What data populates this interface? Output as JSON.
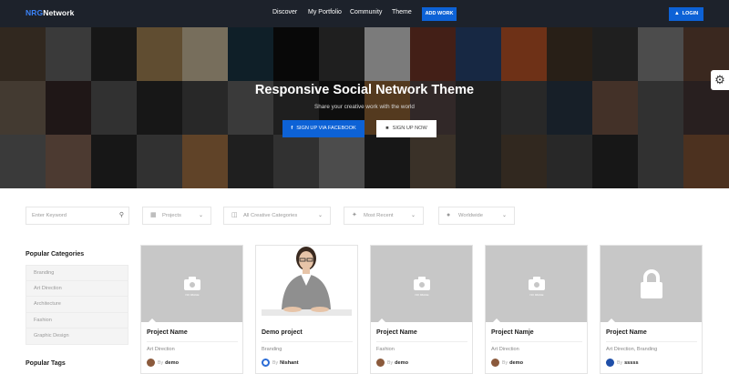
{
  "brand": {
    "part1": "NRG",
    "part2": "Network"
  },
  "nav": {
    "items": [
      "Discover",
      "My Portfolio",
      "Community",
      "Theme"
    ],
    "add_work": "ADD WORK",
    "login": "LOGIN"
  },
  "hero": {
    "title": "Responsive Social Network Theme",
    "subtitle": "Share your creative work with the world",
    "btn_facebook": "SIGN UP VIA FACEBOOK",
    "btn_signup": "SIGN UP NOW"
  },
  "filters": {
    "search_placeholder": "Enter Keyword",
    "type": "Projects",
    "categories": "All Creative Categories",
    "sort": "Most Recent",
    "location": "Worldwide"
  },
  "sidebar": {
    "popular_categories_title": "Popular Categories",
    "categories": [
      "Branding",
      "Art Direction",
      "Architecture",
      "Fashion",
      "Graphic Design"
    ],
    "popular_tags_title": "Popular Tags"
  },
  "cards": [
    {
      "title": "Project Name",
      "category": "Art Direction",
      "by": "By",
      "author": "demo",
      "noimg": "NO IMAGE"
    },
    {
      "title": "Demo project",
      "category": "Branding",
      "by": "By",
      "author": "Nishant"
    },
    {
      "title": "Project Name",
      "category": "Fashion",
      "by": "By",
      "author": "demo",
      "noimg": "NO IMAGE"
    },
    {
      "title": "Project Namje",
      "category": "Art Direction",
      "by": "By",
      "author": "demo",
      "noimg": "NO IMAGE"
    },
    {
      "title": "Project Name",
      "category": "Art Direction, Branding",
      "by": "By",
      "author": "sssss"
    }
  ],
  "colors": {
    "navbar": "#1d222b",
    "accent": "#0d62d6",
    "placeholder_thumb": "#c7c7c7"
  }
}
